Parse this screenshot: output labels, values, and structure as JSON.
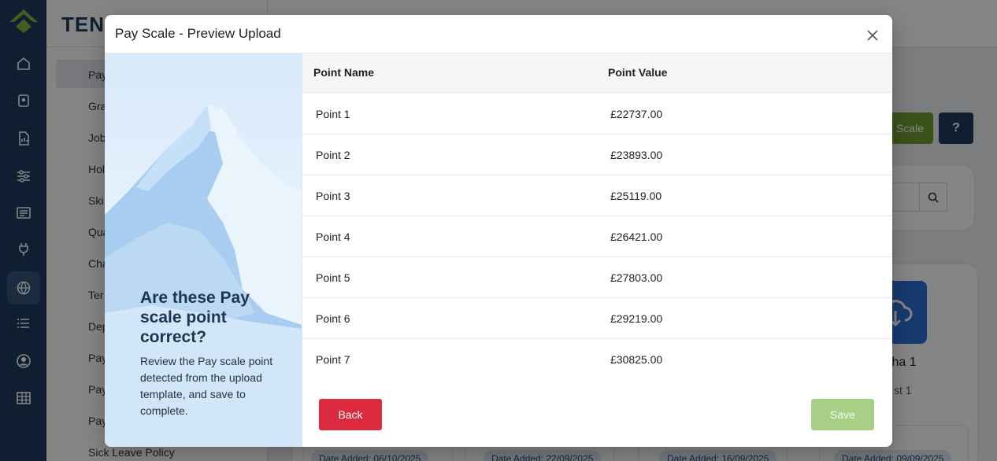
{
  "background": {
    "brand": "TENZ",
    "subnav_items": [
      "Pay",
      "Gra",
      "Job",
      "Hol",
      "Ski",
      "Qua",
      "Cha",
      "Ter",
      "Dep",
      "Pay",
      "Pay",
      "Pay",
      "Sick Leave Policy"
    ],
    "scale_button": "Scale",
    "help_button": "?",
    "card_name": "tha 1",
    "card_sub": "st 1",
    "dates": [
      "Date Added: 06/10/2025",
      "Date Added: 22/09/2025",
      "Date Added: 16/09/2025",
      "Date Added: 09/09/2025"
    ]
  },
  "modal": {
    "title": "Pay Scale - Preview Upload",
    "side": {
      "heading": "Are these Pay scale point correct?",
      "text": "Review the Pay scale point  detected from the upload template, and save to complete."
    },
    "table": {
      "columns": [
        "Point Name",
        "Point Value"
      ],
      "rows": [
        [
          "Point 1",
          "£22737.00"
        ],
        [
          "Point 2",
          "£23893.00"
        ],
        [
          "Point 3",
          "£25119.00"
        ],
        [
          "Point 4",
          "£26421.00"
        ],
        [
          "Point 5",
          "£27803.00"
        ],
        [
          "Point 6",
          "£29219.00"
        ],
        [
          "Point 7",
          "£30825.00"
        ]
      ]
    },
    "back_label": "Back",
    "save_label": "Save"
  },
  "colors": {
    "nav": "#1f3b5e",
    "back_button": "#dc2a3e",
    "save_button_disabled": "#a9cf87",
    "accent_green": "#6f9d33"
  },
  "icons": [
    "home-icon",
    "badge-icon",
    "report-icon",
    "sliders-icon",
    "newspaper-icon",
    "plug-icon",
    "globe-icon",
    "list-icon",
    "user-circle-icon",
    "table-icon",
    "close-icon",
    "search-icon",
    "cloud-download-icon"
  ]
}
